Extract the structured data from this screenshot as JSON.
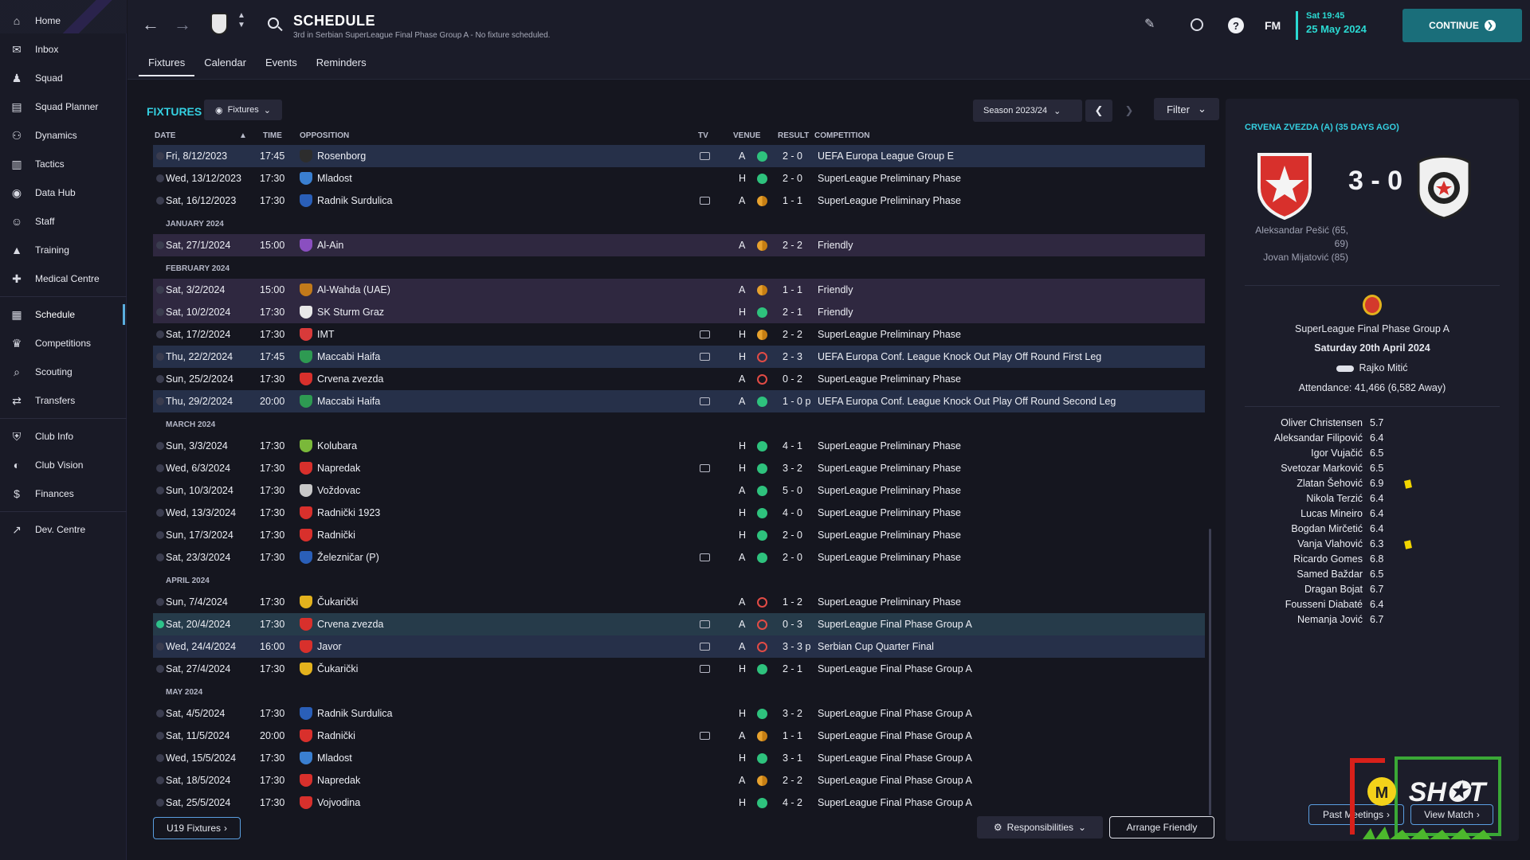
{
  "sidebar": {
    "items": [
      {
        "label": "Home",
        "icon": "home-icon"
      },
      {
        "label": "Inbox",
        "icon": "inbox-icon"
      },
      {
        "label": "Squad",
        "icon": "squad-icon"
      },
      {
        "label": "Squad Planner",
        "icon": "clipboard-icon"
      },
      {
        "label": "Dynamics",
        "icon": "dynamics-icon"
      },
      {
        "label": "Tactics",
        "icon": "tactics-icon"
      },
      {
        "label": "Data Hub",
        "icon": "data-hub-icon"
      },
      {
        "label": "Staff",
        "icon": "staff-icon"
      },
      {
        "label": "Training",
        "icon": "training-icon"
      },
      {
        "label": "Medical Centre",
        "icon": "medical-icon"
      },
      {
        "label": "Schedule",
        "icon": "calendar-icon",
        "active": true
      },
      {
        "label": "Competitions",
        "icon": "trophy-icon"
      },
      {
        "label": "Scouting",
        "icon": "search-icon"
      },
      {
        "label": "Transfers",
        "icon": "transfers-icon"
      },
      {
        "label": "Club Info",
        "icon": "shield-icon"
      },
      {
        "label": "Club Vision",
        "icon": "vision-icon"
      },
      {
        "label": "Finances",
        "icon": "finances-icon"
      },
      {
        "label": "Dev. Centre",
        "icon": "dev-centre-icon"
      }
    ]
  },
  "header": {
    "title": "SCHEDULE",
    "subtitle": "3rd in Serbian SuperLeague Final Phase Group A - No fixture scheduled.",
    "tabs": [
      "Fixtures",
      "Calendar",
      "Events",
      "Reminders"
    ],
    "fm_label": "FM",
    "time": "Sat 19:45",
    "date": "25 May 2024",
    "continue_label": "CONTINUE"
  },
  "fixtures": {
    "title": "FIXTURES",
    "view_dropdown": "Fixtures",
    "season": "Season 2023/24",
    "filter_label": "Filter",
    "columns": {
      "date": "DATE",
      "time": "TIME",
      "opposition": "OPPOSITION",
      "tv": "TV",
      "venue": "VENUE",
      "result": "RESULT",
      "competition": "COMPETITION"
    },
    "rows": [
      {
        "type": "match",
        "date": "Fri, 8/12/2023",
        "time": "17:45",
        "opp": "Rosenborg",
        "tv": true,
        "venue": "A",
        "outcome": "W",
        "result": "2 - 0",
        "comp": "UEFA Europa League Group E",
        "bg": "blue",
        "crest": "#2d2d2d"
      },
      {
        "type": "match",
        "date": "Wed, 13/12/2023",
        "time": "17:30",
        "opp": "Mladost",
        "tv": false,
        "venue": "H",
        "outcome": "W",
        "result": "2 - 0",
        "comp": "SuperLeague Preliminary Phase",
        "bg": "",
        "crest": "#3a7fd0"
      },
      {
        "type": "match",
        "date": "Sat, 16/12/2023",
        "time": "17:30",
        "opp": "Radnik Surdulica",
        "tv": true,
        "venue": "A",
        "outcome": "D",
        "result": "1 - 1",
        "comp": "SuperLeague Preliminary Phase",
        "bg": "",
        "crest": "#2a5fb8"
      },
      {
        "type": "month",
        "label": "JANUARY 2024"
      },
      {
        "type": "match",
        "date": "Sat, 27/1/2024",
        "time": "15:00",
        "opp": "Al-Ain",
        "tv": false,
        "venue": "A",
        "outcome": "D",
        "result": "2 - 2",
        "comp": "Friendly",
        "bg": "purple",
        "crest": "#8a4fc0"
      },
      {
        "type": "month",
        "label": "FEBRUARY 2024"
      },
      {
        "type": "match",
        "date": "Sat, 3/2/2024",
        "time": "15:00",
        "opp": "Al-Wahda (UAE)",
        "tv": false,
        "venue": "A",
        "outcome": "D",
        "result": "1 - 1",
        "comp": "Friendly",
        "bg": "purple",
        "crest": "#c27a1a"
      },
      {
        "type": "match",
        "date": "Sat, 10/2/2024",
        "time": "17:30",
        "opp": "SK Sturm Graz",
        "tv": false,
        "venue": "H",
        "outcome": "W",
        "result": "2 - 1",
        "comp": "Friendly",
        "bg": "purple",
        "crest": "#e8e8e8"
      },
      {
        "type": "match",
        "date": "Sat, 17/2/2024",
        "time": "17:30",
        "opp": "IMT",
        "tv": true,
        "venue": "H",
        "outcome": "D",
        "result": "2 - 2",
        "comp": "SuperLeague Preliminary Phase",
        "bg": "",
        "crest": "#d83a3a"
      },
      {
        "type": "match",
        "date": "Thu, 22/2/2024",
        "time": "17:45",
        "opp": "Maccabi Haifa",
        "tv": true,
        "venue": "H",
        "outcome": "L",
        "result": "2 - 3",
        "comp": "UEFA Europa Conf. League Knock Out Play Off Round First Leg",
        "bg": "blue",
        "crest": "#2e9a52"
      },
      {
        "type": "match",
        "date": "Sun, 25/2/2024",
        "time": "17:30",
        "opp": "Crvena zvezda",
        "tv": false,
        "venue": "A",
        "outcome": "L",
        "result": "0 - 2",
        "comp": "SuperLeague Preliminary Phase",
        "bg": "",
        "crest": "#d8302c"
      },
      {
        "type": "match",
        "date": "Thu, 29/2/2024",
        "time": "20:00",
        "opp": "Maccabi Haifa",
        "tv": true,
        "venue": "A",
        "outcome": "W",
        "result": "1 - 0 p",
        "comp": "UEFA Europa Conf. League Knock Out Play Off Round Second Leg",
        "bg": "blue",
        "crest": "#2e9a52"
      },
      {
        "type": "month",
        "label": "MARCH 2024"
      },
      {
        "type": "match",
        "date": "Sun, 3/3/2024",
        "time": "17:30",
        "opp": "Kolubara",
        "tv": false,
        "venue": "H",
        "outcome": "W",
        "result": "4 - 1",
        "comp": "SuperLeague Preliminary Phase",
        "bg": "",
        "crest": "#7ab83a"
      },
      {
        "type": "match",
        "date": "Wed, 6/3/2024",
        "time": "17:30",
        "opp": "Napredak",
        "tv": true,
        "venue": "H",
        "outcome": "W",
        "result": "3 - 2",
        "comp": "SuperLeague Preliminary Phase",
        "bg": "",
        "crest": "#d8302c"
      },
      {
        "type": "match",
        "date": "Sun, 10/3/2024",
        "time": "17:30",
        "opp": "Voždovac",
        "tv": false,
        "venue": "A",
        "outcome": "W",
        "result": "5 - 0",
        "comp": "SuperLeague Preliminary Phase",
        "bg": "",
        "crest": "#c8c8c8"
      },
      {
        "type": "match",
        "date": "Wed, 13/3/2024",
        "time": "17:30",
        "opp": "Radnički 1923",
        "tv": false,
        "venue": "H",
        "outcome": "W",
        "result": "4 - 0",
        "comp": "SuperLeague Preliminary Phase",
        "bg": "",
        "crest": "#d8302c"
      },
      {
        "type": "match",
        "date": "Sun, 17/3/2024",
        "time": "17:30",
        "opp": "Radnički",
        "tv": false,
        "venue": "H",
        "outcome": "W",
        "result": "2 - 0",
        "comp": "SuperLeague Preliminary Phase",
        "bg": "",
        "crest": "#d8302c"
      },
      {
        "type": "match",
        "date": "Sat, 23/3/2024",
        "time": "17:30",
        "opp": "Železničar (P)",
        "tv": true,
        "venue": "A",
        "outcome": "W",
        "result": "2 - 0",
        "comp": "SuperLeague Preliminary Phase",
        "bg": "",
        "crest": "#2a5fb8"
      },
      {
        "type": "month",
        "label": "APRIL 2024"
      },
      {
        "type": "match",
        "date": "Sun, 7/4/2024",
        "time": "17:30",
        "opp": "Čukarički",
        "tv": false,
        "venue": "A",
        "outcome": "L",
        "result": "1 - 2",
        "comp": "SuperLeague Preliminary Phase",
        "bg": "",
        "crest": "#e3b21d"
      },
      {
        "type": "match",
        "date": "Sat, 20/4/2024",
        "time": "17:30",
        "opp": "Crvena zvezda",
        "tv": true,
        "venue": "A",
        "outcome": "L",
        "result": "0 - 3",
        "comp": "SuperLeague Final Phase Group A",
        "bg": "hl",
        "crest": "#d8302c",
        "checked": true
      },
      {
        "type": "match",
        "date": "Wed, 24/4/2024",
        "time": "16:00",
        "opp": "Javor",
        "tv": true,
        "venue": "A",
        "outcome": "L",
        "result": "3 - 3 p",
        "comp": "Serbian Cup Quarter Final",
        "bg": "blue",
        "crest": "#d8302c"
      },
      {
        "type": "match",
        "date": "Sat, 27/4/2024",
        "time": "17:30",
        "opp": "Čukarički",
        "tv": true,
        "venue": "H",
        "outcome": "W",
        "result": "2 - 1",
        "comp": "SuperLeague Final Phase Group A",
        "bg": "",
        "crest": "#e3b21d"
      },
      {
        "type": "month",
        "label": "MAY 2024"
      },
      {
        "type": "match",
        "date": "Sat, 4/5/2024",
        "time": "17:30",
        "opp": "Radnik Surdulica",
        "tv": false,
        "venue": "H",
        "outcome": "W",
        "result": "3 - 2",
        "comp": "SuperLeague Final Phase Group A",
        "bg": "",
        "crest": "#2a5fb8"
      },
      {
        "type": "match",
        "date": "Sat, 11/5/2024",
        "time": "20:00",
        "opp": "Radnički",
        "tv": true,
        "venue": "A",
        "outcome": "D",
        "result": "1 - 1",
        "comp": "SuperLeague Final Phase Group A",
        "bg": "",
        "crest": "#d8302c"
      },
      {
        "type": "match",
        "date": "Wed, 15/5/2024",
        "time": "17:30",
        "opp": "Mladost",
        "tv": false,
        "venue": "H",
        "outcome": "W",
        "result": "3 - 1",
        "comp": "SuperLeague Final Phase Group A",
        "bg": "",
        "crest": "#3a7fd0"
      },
      {
        "type": "match",
        "date": "Sat, 18/5/2024",
        "time": "17:30",
        "opp": "Napredak",
        "tv": false,
        "venue": "A",
        "outcome": "D",
        "result": "2 - 2",
        "comp": "SuperLeague Final Phase Group A",
        "bg": "",
        "crest": "#d8302c"
      },
      {
        "type": "match",
        "date": "Sat, 25/5/2024",
        "time": "17:30",
        "opp": "Vojvodina",
        "tv": false,
        "venue": "H",
        "outcome": "W",
        "result": "4 - 2",
        "comp": "SuperLeague Final Phase Group A",
        "bg": "",
        "crest": "#d8302c"
      }
    ],
    "u19_label": "U19 Fixtures",
    "responsibilities_label": "Responsibilities",
    "arrange_label": "Arrange Friendly"
  },
  "match_panel": {
    "heading": "CRVENA ZVEZDA (A) (35 DAYS AGO)",
    "score": "3 - 0",
    "scorers": [
      "Aleksandar Pešić (65,",
      "69)",
      "Jovan Mijatović (85)"
    ],
    "competition": "SuperLeague Final Phase Group A",
    "date": "Saturday 20th April 2024",
    "referee": "Rajko Mitić",
    "attendance": "Attendance: 41,466 (6,582 Away)",
    "players": [
      {
        "name": "Oliver Christensen",
        "rating": "5.7",
        "yellow": false
      },
      {
        "name": "Aleksandar Filipović",
        "rating": "6.4",
        "yellow": false
      },
      {
        "name": "Igor Vujačić",
        "rating": "6.5",
        "yellow": false
      },
      {
        "name": "Svetozar Marković",
        "rating": "6.5",
        "yellow": false
      },
      {
        "name": "Zlatan Šehović",
        "rating": "6.9",
        "yellow": true
      },
      {
        "name": "Nikola Terzić",
        "rating": "6.4",
        "yellow": false
      },
      {
        "name": "Lucas Mineiro",
        "rating": "6.4",
        "yellow": false
      },
      {
        "name": "Bogdan Mirčetić",
        "rating": "6.4",
        "yellow": false
      },
      {
        "name": "Vanja Vlahović",
        "rating": "6.3",
        "yellow": true
      },
      {
        "name": "Ricardo Gomes",
        "rating": "6.8",
        "yellow": false
      },
      {
        "name": "Samed Baždar",
        "rating": "6.5",
        "yellow": false
      },
      {
        "name": "Dragan Bojat",
        "rating": "6.7",
        "yellow": false
      },
      {
        "name": "Fousseni Diabaté",
        "rating": "6.4",
        "yellow": false
      },
      {
        "name": "Nemanja Jović",
        "rating": "6.7",
        "yellow": false
      }
    ],
    "past_meetings_label": "Past Meetings",
    "view_match_label": "View Match"
  },
  "colors": {
    "accent": "#34cfe0",
    "win": "#2ec27d",
    "draw": "#e8a22e",
    "loss": "#e24b45",
    "continue": "#1a6e7a"
  }
}
